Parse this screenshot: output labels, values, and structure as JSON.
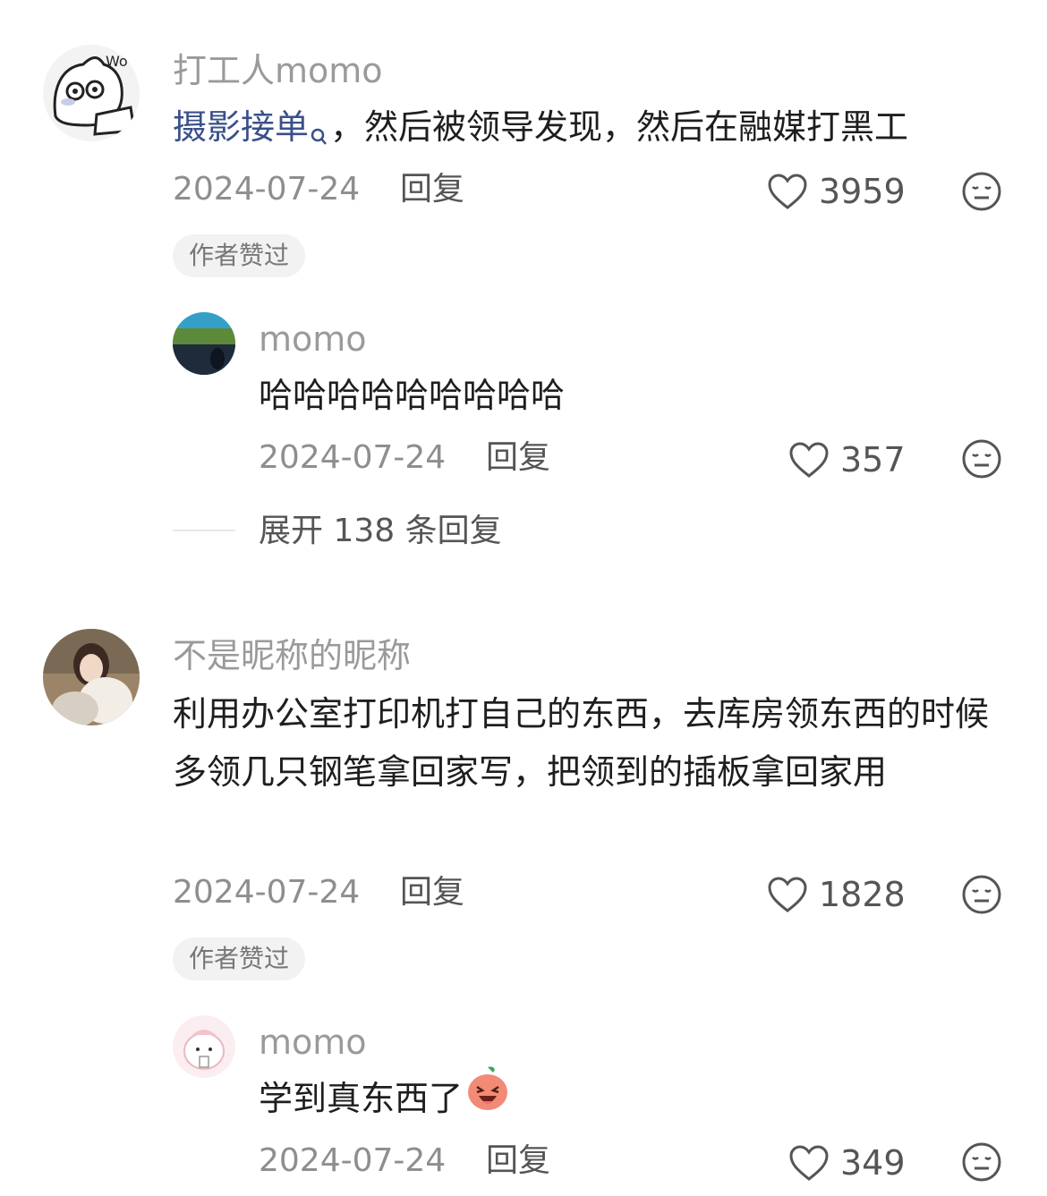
{
  "comments": [
    {
      "username": "打工人momo",
      "text_link": "摄影接单",
      "text_rest": "，然后被领导发现，然后在融媒打黑工",
      "date": "2024-07-24",
      "reply_label": "回复",
      "likes": "3959",
      "badge": "作者赞过",
      "avatar_icon": "cat-sticker-avatar",
      "replies": [
        {
          "username": "momo",
          "text": "哈哈哈哈哈哈哈哈哈",
          "date": "2024-07-24",
          "reply_label": "回复",
          "likes": "357"
        }
      ],
      "expand_label": "展开 138 条回复"
    },
    {
      "username": "不是昵称的昵称",
      "text": "利用办公室打印机打自己的东西，去库房领东西的时候多领几只钢笔拿回家写，把领到的插板拿回家用",
      "date": "2024-07-24",
      "reply_label": "回复",
      "likes": "1828",
      "badge": "作者赞过",
      "replies": [
        {
          "username": "momo",
          "text": "学到真东西了",
          "date": "2024-07-24",
          "reply_label": "回复",
          "likes": "349"
        }
      ]
    }
  ],
  "colors": {
    "username": "#9a9a9a",
    "link": "#3a4f8a",
    "badge_bg": "#f2f2f2"
  }
}
